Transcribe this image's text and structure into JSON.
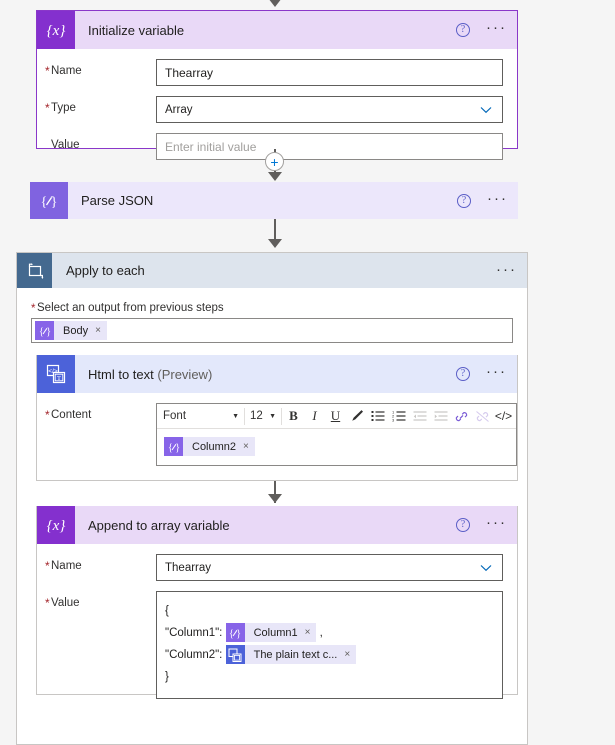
{
  "flow": {
    "connector_add_label": "+",
    "steps": [
      {
        "id": "initialize-variable",
        "title": "Initialize variable",
        "icon": "variable-braces-x-icon",
        "help_label": "?",
        "menu_label": "···",
        "fields": [
          {
            "label": "Name",
            "required": true,
            "control": "textbox",
            "value": "Thearray",
            "placeholder": ""
          },
          {
            "label": "Type",
            "required": true,
            "control": "dropdown",
            "value": "Array",
            "placeholder": ""
          },
          {
            "label": "Value",
            "required": false,
            "control": "textbox",
            "value": "",
            "placeholder": "Enter initial value"
          }
        ]
      },
      {
        "id": "parse-json",
        "title": "Parse JSON",
        "icon": "parse-json-braces-icon",
        "help_label": "?",
        "menu_label": "···"
      },
      {
        "id": "apply-to-each",
        "title": "Apply to each",
        "icon": "loop-foreach-icon",
        "menu_label": "···",
        "output_field": {
          "label": "Select an output from previous steps",
          "required": true,
          "token": {
            "text": "Body",
            "icon": "parse-json-braces-icon",
            "icon_color": "purple",
            "remove_label": "×"
          }
        }
      },
      {
        "id": "html-to-text",
        "title": "Html to text",
        "title_suffix": "(Preview)",
        "icon": "html-to-text-icon",
        "help_label": "?",
        "menu_label": "···",
        "content_field": {
          "label": "Content",
          "required": true,
          "toolbar": {
            "font_name": "Font",
            "font_size": "12",
            "bold": "B",
            "italic": "I",
            "underline": "U",
            "highlight_icon": "highlighter-pen-icon",
            "bullet_list_icon": "bulleted-list-icon",
            "numbered_list_icon": "numbered-list-icon",
            "outdent_icon": "decrease-indent-icon",
            "indent_icon": "increase-indent-icon",
            "link_icon": "insert-link-icon",
            "unlink_icon": "remove-link-icon",
            "code_icon": "code-view-icon",
            "code_label": "</>"
          },
          "token": {
            "text": "Column2",
            "icon": "parse-json-braces-icon",
            "icon_color": "purple",
            "remove_label": "×"
          }
        }
      },
      {
        "id": "append-to-array-variable",
        "title": "Append to array variable",
        "icon": "variable-braces-x-icon",
        "help_label": "?",
        "menu_label": "···",
        "fields": [
          {
            "label": "Name",
            "required": true,
            "control": "dropdown",
            "value": "Thearray",
            "placeholder": ""
          }
        ],
        "value_field": {
          "label": "Value",
          "required": true,
          "lines": [
            {
              "prefix": "{",
              "token": null,
              "suffix": ""
            },
            {
              "prefix": "\"Column1\":",
              "token": {
                "text": "Column1",
                "icon": "parse-json-braces-icon",
                "icon_color": "purple",
                "remove_label": "×"
              },
              "suffix": ","
            },
            {
              "prefix": "\"Column2\":",
              "token": {
                "text": "The plain text c...",
                "icon": "html-to-text-icon",
                "icon_color": "blue",
                "remove_label": "×"
              },
              "suffix": ""
            },
            {
              "prefix": "}",
              "token": null,
              "suffix": ""
            }
          ]
        }
      }
    ]
  },
  "colors": {
    "variable_accent": "#8430ce",
    "variable_header": "#e9d9f7",
    "parse_json_accent": "#8063e0",
    "parse_json_header": "#ece7fb",
    "html_accent": "#4c62d9",
    "html_header": "#e3e8fb",
    "scope_accent": "#44698f",
    "scope_header": "#dde4ed",
    "required_asterisk": "#a4262c",
    "page_background": "#f5f5f5",
    "link_blue": "#0067b8"
  }
}
